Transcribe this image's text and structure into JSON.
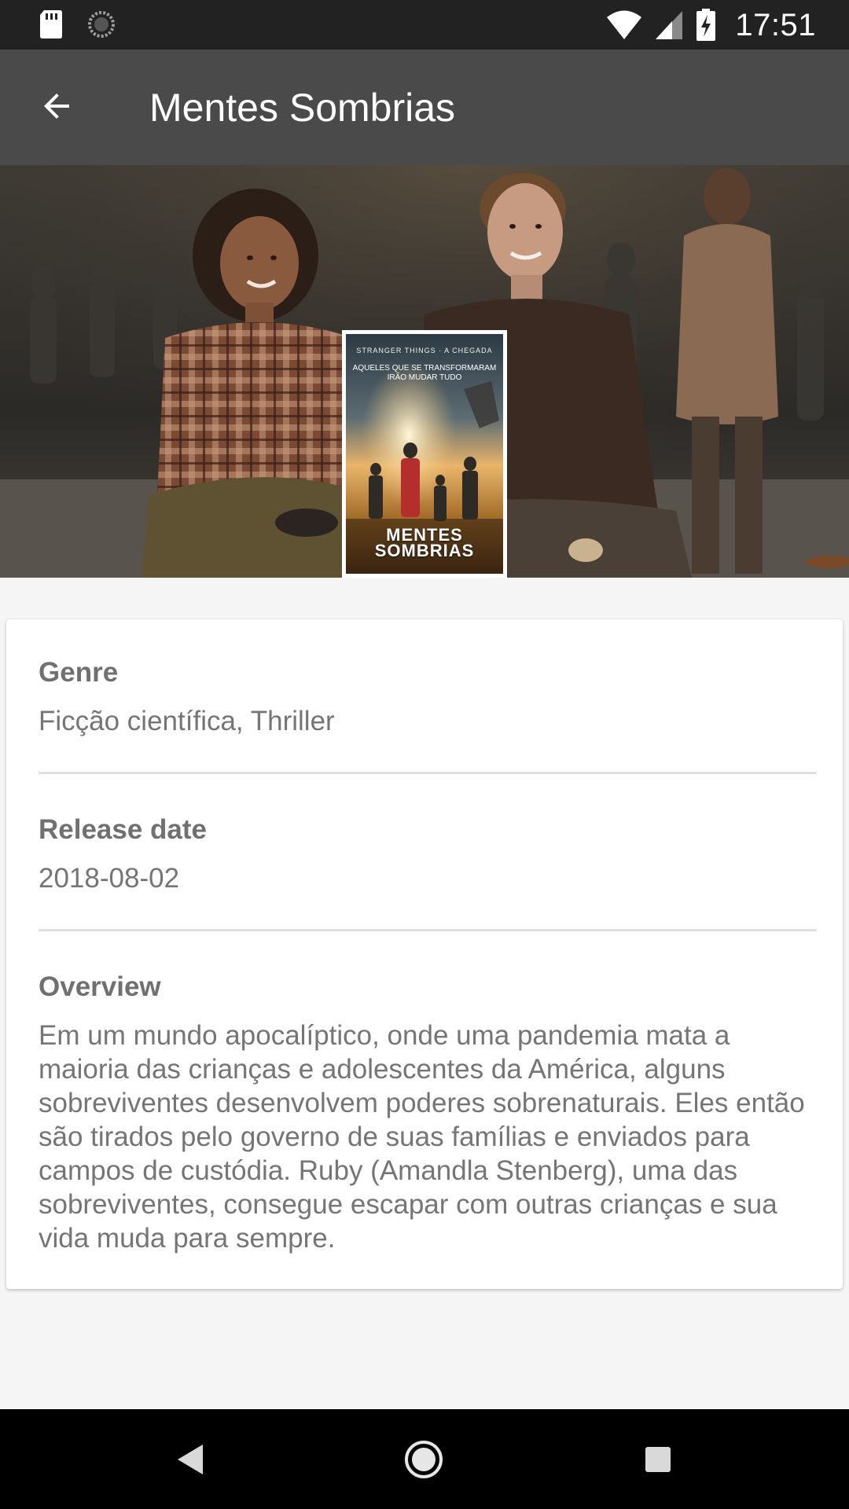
{
  "status_bar": {
    "time": "17:51",
    "icons": [
      "sd-card-icon",
      "sync-icon",
      "wifi-icon",
      "cell-signal-icon",
      "battery-charging-icon"
    ]
  },
  "toolbar": {
    "back_icon": "arrow-back-icon",
    "title": "Mentes Sombrias"
  },
  "poster": {
    "tagline": "STRANGER THINGS  ·  A CHEGADA",
    "subline": [
      "AQUELES QUE SE TRANSFORMARAM",
      "IRÃO MUDAR TUDO"
    ],
    "title": [
      "MENTES",
      "SOMBRIAS"
    ]
  },
  "details": {
    "genre_label": "Genre",
    "genre_value": "Ficção científica, Thriller",
    "release_label": "Release date",
    "release_value": "2018-08-02",
    "overview_label": "Overview",
    "overview_value": "Em um mundo apocalíptico, onde uma pandemia mata a maioria das crianças e adolescentes da América, alguns sobreviventes desenvolvem poderes sobrenaturais. Eles então são tirados pelo governo de suas famílias e enviados para campos de custódia. Ruby (Amandla Stenberg), uma das sobreviventes, consegue escapar com outras crianças e sua vida muda para sempre."
  },
  "nav_bar": {
    "back_icon": "nav-back-icon",
    "home_icon": "nav-home-icon",
    "recents_icon": "nav-recents-icon"
  },
  "colors": {
    "status_bar": "#222222",
    "toolbar": "#4a4a4a",
    "background": "#f5f5f5",
    "card": "#ffffff",
    "label_text": "#707070",
    "value_text": "#757575",
    "divider": "#e0e0e0"
  }
}
